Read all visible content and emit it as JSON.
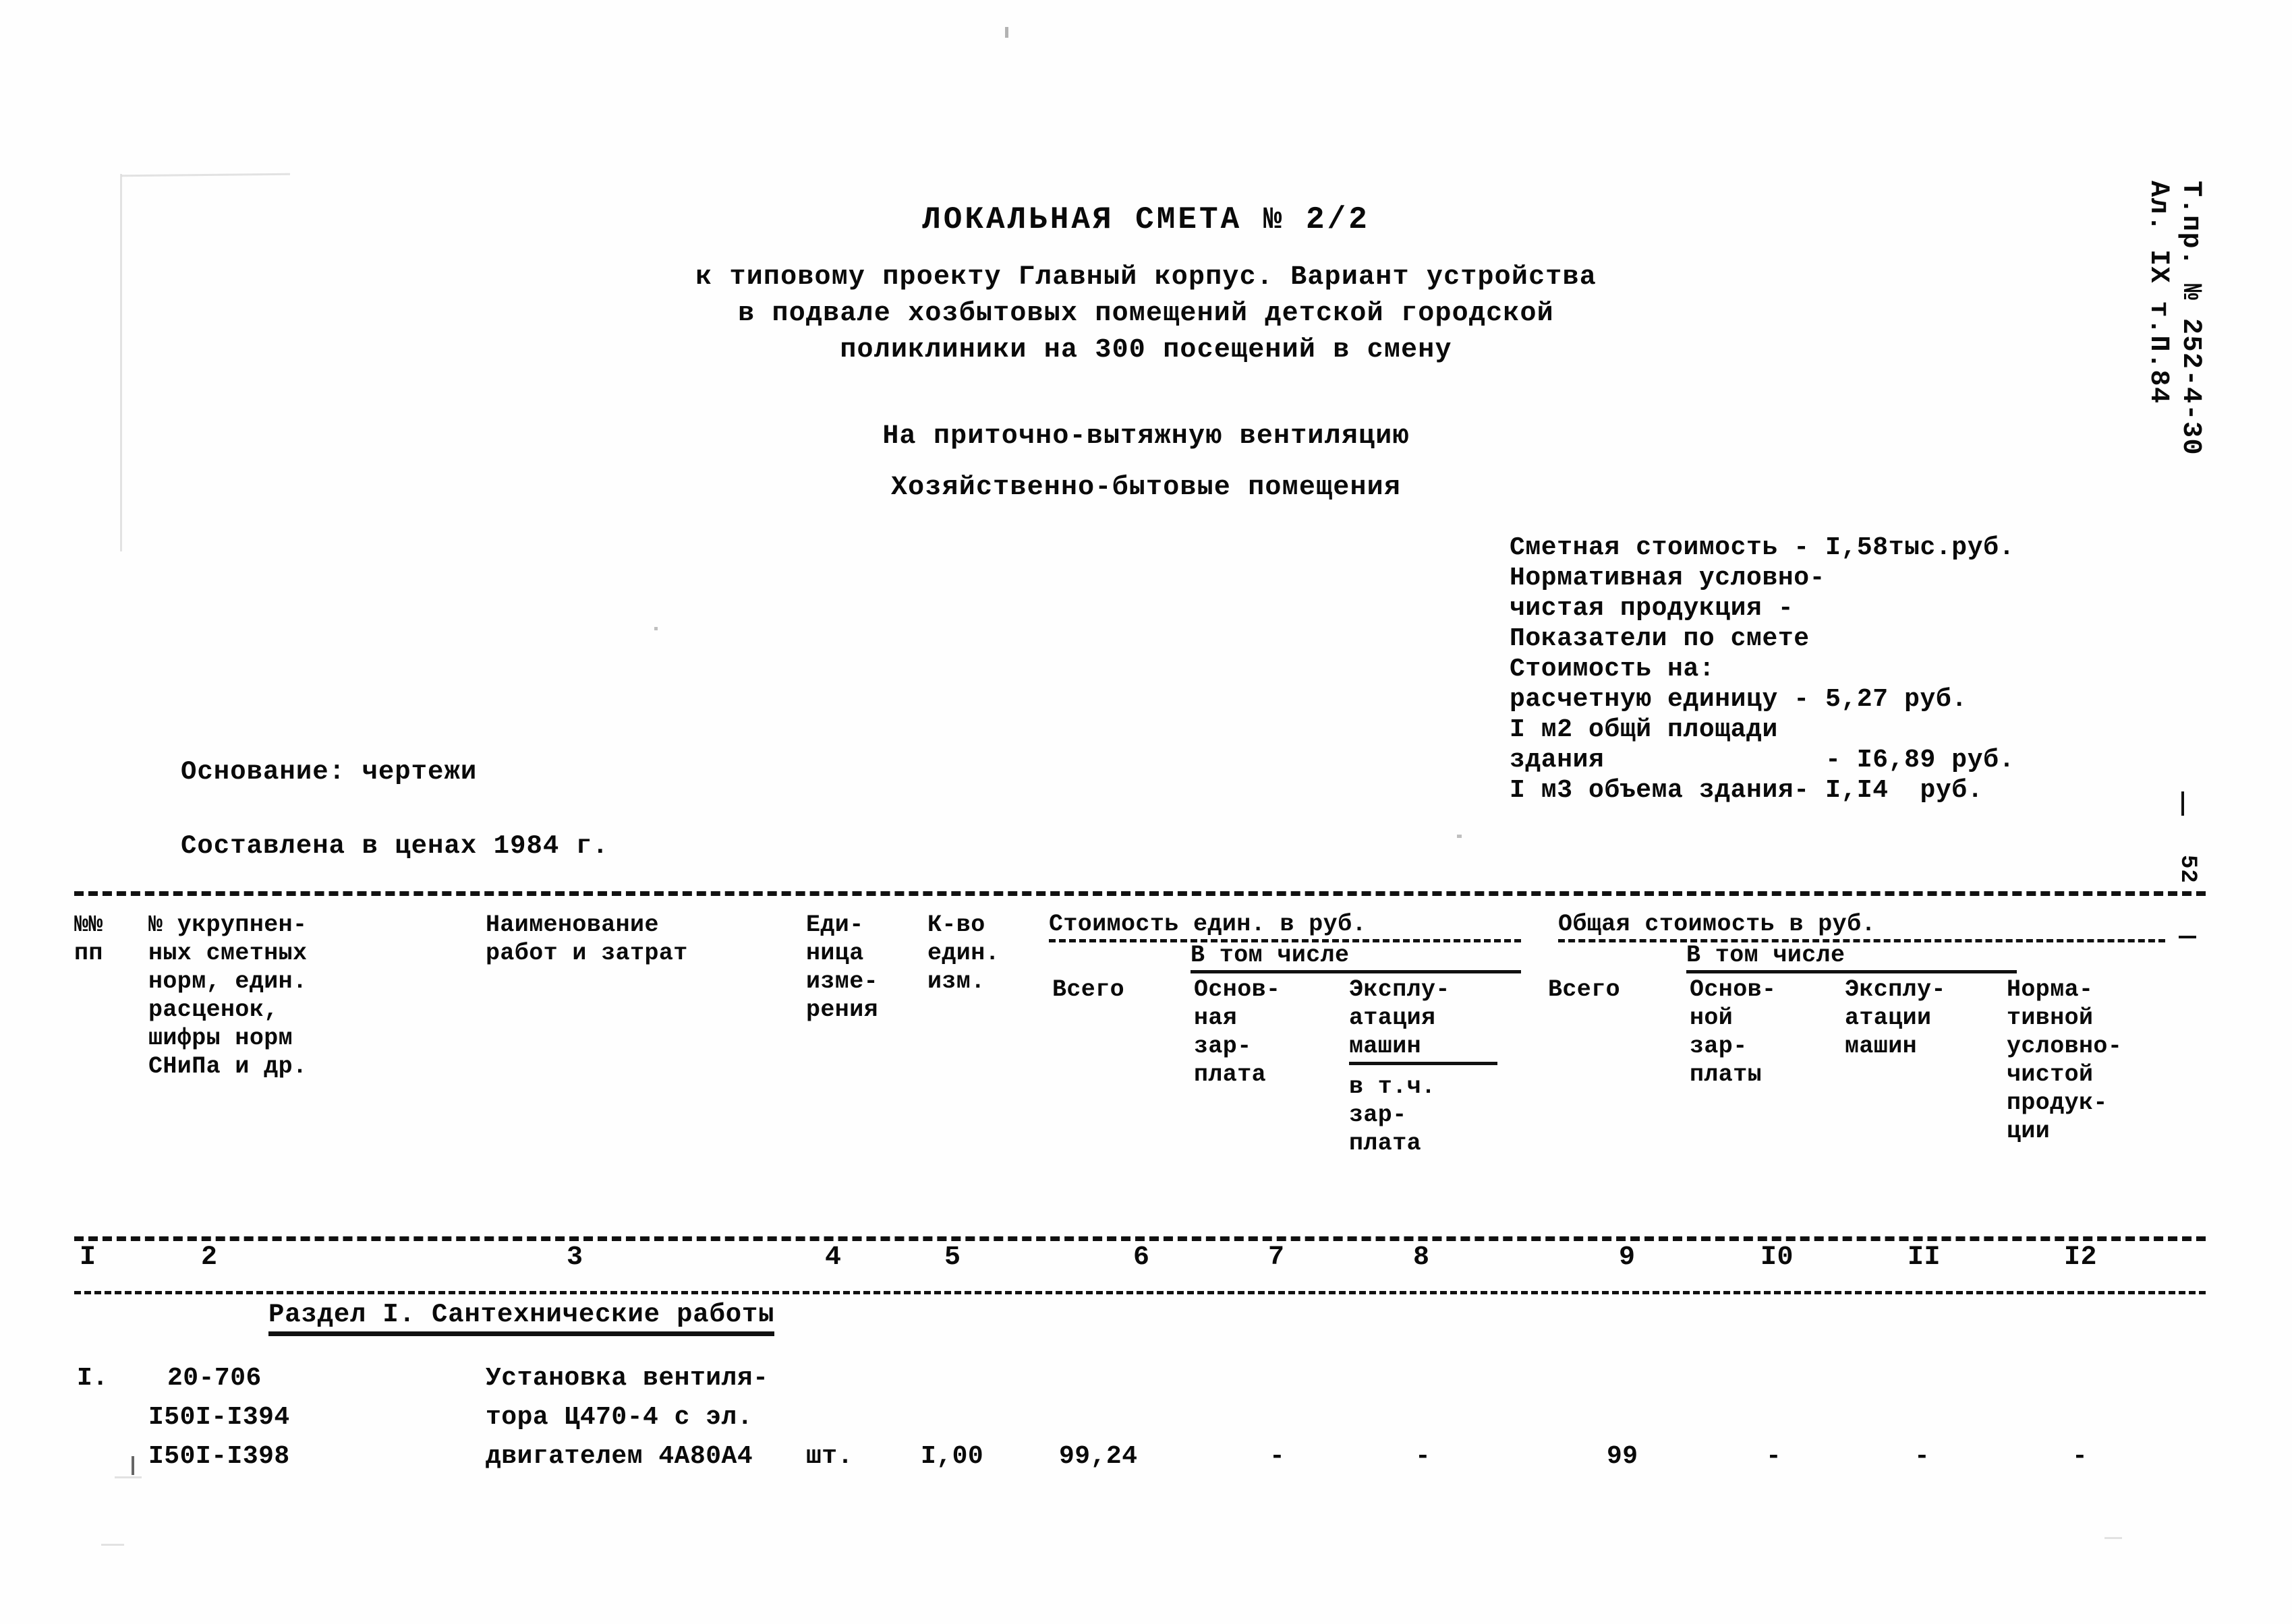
{
  "document": {
    "title": "ЛОКАЛЬНАЯ СМЕТА № 2/2",
    "subtitle_line_1": "к типовому проекту  Главный корпус. Вариант устройства",
    "subtitle_line_2": "в подвале хозбытовых помещений детской городской",
    "subtitle_line_3": "поликлиники на 300 посещений в смену",
    "purpose_line_1": "На приточно-вытяжную вентиляцию",
    "purpose_line_2": "Хозяйственно-бытовые помещения"
  },
  "summary": {
    "row_1": "Сметная стоимость - I,58тыс.руб.",
    "row_2": "Нормативная условно-",
    "row_3": "чистая продукция -",
    "row_4": "Показатели по смете",
    "row_5": "Стоимость на:",
    "row_6": "расчетную единицу - 5,27 руб.",
    "row_7": "I м2 общй площади",
    "row_8": "здания              - I6,89 руб.",
    "row_9": "I м3 объема здания- I,I4  руб."
  },
  "basis": {
    "line_1": "Основание: чертежи",
    "line_2": "Составлена в ценах 1984 г."
  },
  "margin": {
    "vertical_line_1": "Т.пр. № 252-4-30",
    "vertical_line_2": "Ал. IX т.П.84",
    "page_number": "52"
  },
  "table": {
    "headers": {
      "col1": "№№\nпп",
      "col2": "№ укрупнен-\nных сметных\nнорм, един.\nрасценок,\nшифры норм\nСНиПа и др.",
      "col3": "Наименование\nработ и затрат",
      "col4": "Еди-\nница\nизме-\nрения",
      "col5": "К-во\nедин.\nизм.",
      "group_unit_cost": "Стоимость един. в руб.",
      "group_unit_incl": "В том числе",
      "col6": "Всего",
      "col7": "Основ-\nная\nзар-\nплата",
      "col8_a": "Эксплу-\nатация\nмашин",
      "col8_b": "в т.ч.\nзар-\nплата",
      "group_total_cost": "Общая стоимость в руб.",
      "group_total_incl": "В том числе",
      "col9": "Всего",
      "col10": "Основ-\nной\nзар-\nплаты",
      "col11": "Эксплу-\nатации\nмашин",
      "col12": "Норма-\nтивной\nусловно-\nчистой\nпродук-\nции"
    },
    "column_numbers": [
      "I",
      "2",
      "3",
      "4",
      "5",
      "6",
      "7",
      "8",
      "9",
      "I0",
      "II",
      "I2"
    ],
    "section_title": "Раздел I. Сантехнические работы",
    "rows": [
      {
        "num": "I.",
        "code_line_1": "20-706",
        "code_line_2": "I50I-I394",
        "code_line_3": "I50I-I398",
        "name_line_1": "Установка вентиля-",
        "name_line_2": "тора Ц470-4 с эл.",
        "name_line_3": "двигателем 4А80А4",
        "unit": "шт.",
        "qty": "I,00",
        "unit_total": "99,24",
        "unit_basic_wage": "-",
        "unit_machine": "-",
        "total": "99",
        "total_basic_wage": "-",
        "total_machine": "-",
        "total_nucp": "-"
      }
    ]
  }
}
